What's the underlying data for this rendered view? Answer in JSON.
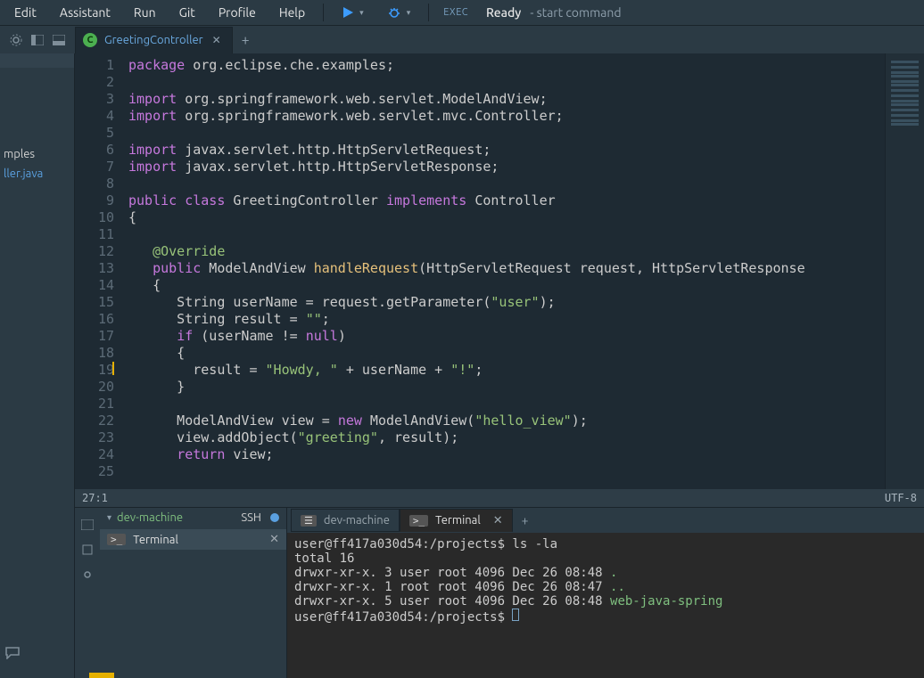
{
  "menu": {
    "edit": "Edit",
    "assistant": "Assistant",
    "run": "Run",
    "git": "Git",
    "profile": "Profile",
    "help": "Help"
  },
  "toolbar": {
    "exec": "EXEC",
    "ready": "Ready",
    "start_command": "- start command"
  },
  "tab": {
    "badge_letter": "C",
    "title": "GreetingController"
  },
  "project_tree": {
    "folder": "mples",
    "file": "ller.java"
  },
  "status": {
    "cursor": "27:1",
    "encoding": "UTF-8"
  },
  "code": {
    "lines": [
      {
        "n": 1,
        "segs": [
          {
            "t": "package",
            "c": "kw-pkg"
          },
          {
            "t": " org.eclipse.che.examples;",
            "c": ""
          }
        ]
      },
      {
        "n": 2,
        "segs": []
      },
      {
        "n": 3,
        "segs": [
          {
            "t": "import",
            "c": "kw-imp"
          },
          {
            "t": " org.springframework.web.servlet.ModelAndView;",
            "c": ""
          }
        ]
      },
      {
        "n": 4,
        "segs": [
          {
            "t": "import",
            "c": "kw-imp"
          },
          {
            "t": " org.springframework.web.servlet.mvc.Controller;",
            "c": ""
          }
        ]
      },
      {
        "n": 5,
        "segs": []
      },
      {
        "n": 6,
        "segs": [
          {
            "t": "import",
            "c": "kw-imp"
          },
          {
            "t": " javax.servlet.http.HttpServletRequest;",
            "c": ""
          }
        ]
      },
      {
        "n": 7,
        "segs": [
          {
            "t": "import",
            "c": "kw-imp"
          },
          {
            "t": " javax.servlet.http.HttpServletResponse;",
            "c": ""
          }
        ]
      },
      {
        "n": 8,
        "segs": []
      },
      {
        "n": 9,
        "segs": [
          {
            "t": "public",
            "c": "kw-pub"
          },
          {
            "t": " ",
            "c": ""
          },
          {
            "t": "class",
            "c": "kw-cls"
          },
          {
            "t": " GreetingController ",
            "c": ""
          },
          {
            "t": "implements",
            "c": "kw-impl"
          },
          {
            "t": " Controller",
            "c": ""
          }
        ]
      },
      {
        "n": 10,
        "segs": [
          {
            "t": "{",
            "c": ""
          }
        ]
      },
      {
        "n": 11,
        "segs": []
      },
      {
        "n": 12,
        "segs": [
          {
            "t": "   ",
            "c": ""
          },
          {
            "t": "@Override",
            "c": "anno"
          }
        ]
      },
      {
        "n": 13,
        "segs": [
          {
            "t": "   ",
            "c": ""
          },
          {
            "t": "public",
            "c": "kw-pub"
          },
          {
            "t": " ModelAndView ",
            "c": ""
          },
          {
            "t": "handleRequest",
            "c": "fn"
          },
          {
            "t": "(HttpServletRequest request, HttpServletResponse",
            "c": ""
          }
        ]
      },
      {
        "n": 14,
        "segs": [
          {
            "t": "   {",
            "c": ""
          }
        ]
      },
      {
        "n": 15,
        "segs": [
          {
            "t": "      String userName = request.getParameter(",
            "c": ""
          },
          {
            "t": "\"user\"",
            "c": "str"
          },
          {
            "t": ");",
            "c": ""
          }
        ]
      },
      {
        "n": 16,
        "segs": [
          {
            "t": "      String result = ",
            "c": ""
          },
          {
            "t": "\"\"",
            "c": "str"
          },
          {
            "t": ";",
            "c": ""
          }
        ]
      },
      {
        "n": 17,
        "segs": [
          {
            "t": "      ",
            "c": ""
          },
          {
            "t": "if",
            "c": "kw-if"
          },
          {
            "t": " (userName != ",
            "c": ""
          },
          {
            "t": "null",
            "c": "kw-null"
          },
          {
            "t": ")",
            "c": ""
          }
        ]
      },
      {
        "n": 18,
        "segs": [
          {
            "t": "      {",
            "c": ""
          }
        ]
      },
      {
        "n": 19,
        "segs": [
          {
            "t": "        result = ",
            "c": ""
          },
          {
            "t": "\"Howdy, \"",
            "c": "str"
          },
          {
            "t": " + userName + ",
            "c": ""
          },
          {
            "t": "\"!\"",
            "c": "str"
          },
          {
            "t": ";",
            "c": ""
          }
        ],
        "caret": true
      },
      {
        "n": 20,
        "segs": [
          {
            "t": "      }",
            "c": ""
          }
        ]
      },
      {
        "n": 21,
        "segs": []
      },
      {
        "n": 22,
        "segs": [
          {
            "t": "      ModelAndView view = ",
            "c": ""
          },
          {
            "t": "new",
            "c": "kw-new"
          },
          {
            "t": " ModelAndView(",
            "c": ""
          },
          {
            "t": "\"hello_view\"",
            "c": "str"
          },
          {
            "t": ");",
            "c": ""
          }
        ]
      },
      {
        "n": 23,
        "segs": [
          {
            "t": "      view.addObject(",
            "c": ""
          },
          {
            "t": "\"greeting\"",
            "c": "str"
          },
          {
            "t": ", result);",
            "c": ""
          }
        ]
      },
      {
        "n": 24,
        "segs": [
          {
            "t": "      ",
            "c": ""
          },
          {
            "t": "return",
            "c": "kw-ret"
          },
          {
            "t": " view;",
            "c": ""
          }
        ]
      },
      {
        "n": 25,
        "segs": []
      }
    ]
  },
  "bottom": {
    "machine": "dev-machine",
    "ssh": "SSH",
    "side_terminal": "Terminal",
    "tab_dev": "dev-machine",
    "tab_term": "Terminal",
    "terminal_lines": [
      {
        "segs": [
          {
            "t": "user@ff417a030d54:/projects$ ls -la",
            "c": ""
          }
        ]
      },
      {
        "segs": [
          {
            "t": "total 16",
            "c": ""
          }
        ]
      },
      {
        "segs": [
          {
            "t": "drwxr-xr-x. 3 user root 4096 Dec 26 08:48 ",
            "c": ""
          },
          {
            "t": ".",
            "c": "term-dir"
          }
        ]
      },
      {
        "segs": [
          {
            "t": "drwxr-xr-x. 1 root root 4096 Dec 26 08:47 ",
            "c": ""
          },
          {
            "t": "..",
            "c": "term-dir"
          }
        ]
      },
      {
        "segs": [
          {
            "t": "drwxr-xr-x. 5 user root 4096 Dec 26 08:48 ",
            "c": ""
          },
          {
            "t": "web-java-spring",
            "c": "term-dir"
          }
        ]
      },
      {
        "segs": [
          {
            "t": "user@ff417a030d54:/projects$ ",
            "c": ""
          }
        ],
        "cursor": true
      }
    ]
  }
}
